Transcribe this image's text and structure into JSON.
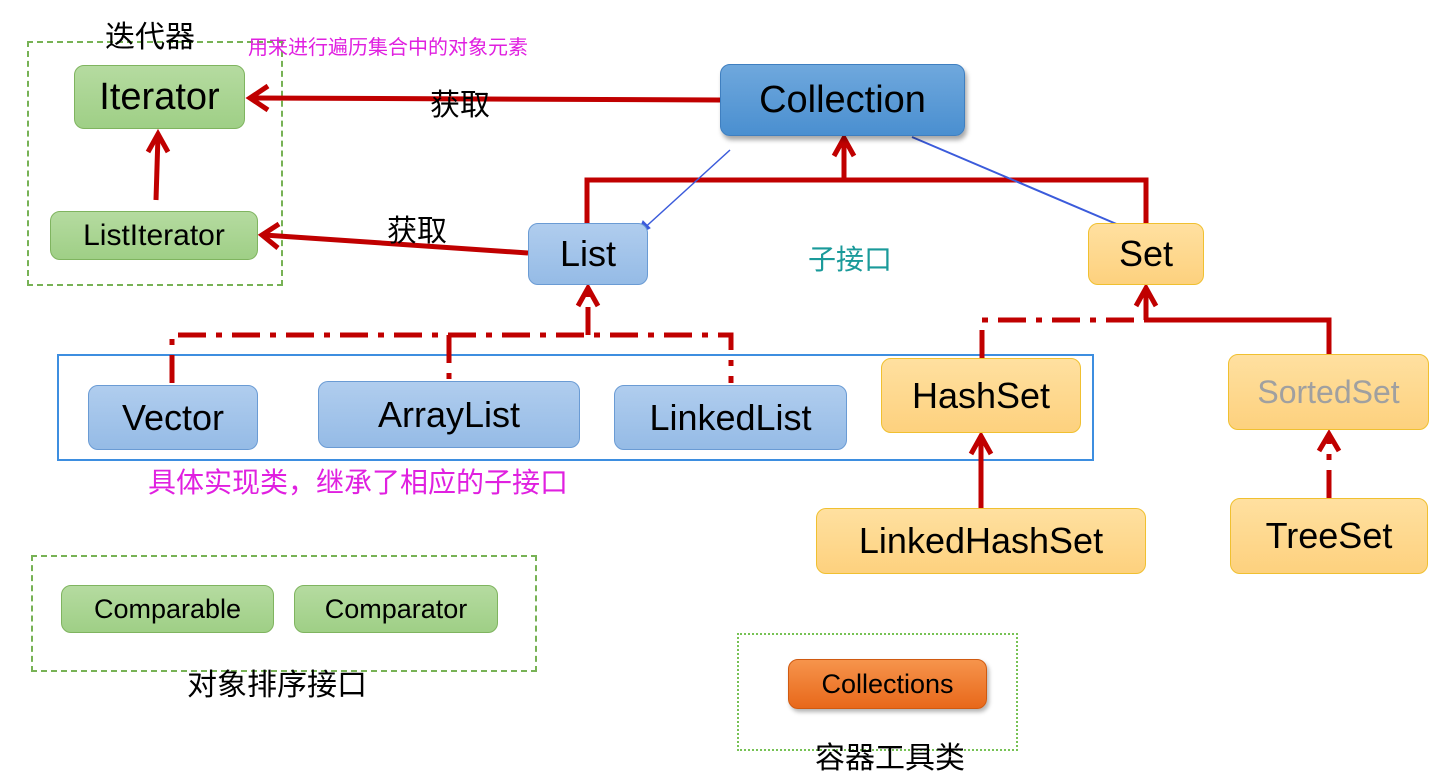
{
  "labels": {
    "iterator_group": "迭代器",
    "iterator_desc": "用来进行遍历集合中的对象元素",
    "obtain_1": "获取",
    "obtain_2": "获取",
    "sub_interface": "子接口",
    "impl_desc": "具体实现类，继承了相应的子接口",
    "sort_interfaces": "对象排序接口",
    "container_utils": "容器工具类"
  },
  "nodes": {
    "iterator": "Iterator",
    "list_iterator": "ListIterator",
    "collection": "Collection",
    "list": "List",
    "set": "Set",
    "vector": "Vector",
    "array_list": "ArrayList",
    "linked_list": "LinkedList",
    "hash_set": "HashSet",
    "sorted_set": "SortedSet",
    "linked_hash_set": "LinkedHashSet",
    "tree_set": "TreeSet",
    "comparable": "Comparable",
    "comparator": "Comparator",
    "collections": "Collections"
  },
  "colors": {
    "relation": "#c00000",
    "pointer": "#3b5bdb",
    "magenta": "#e020e0",
    "teal": "#1a9a9a"
  }
}
